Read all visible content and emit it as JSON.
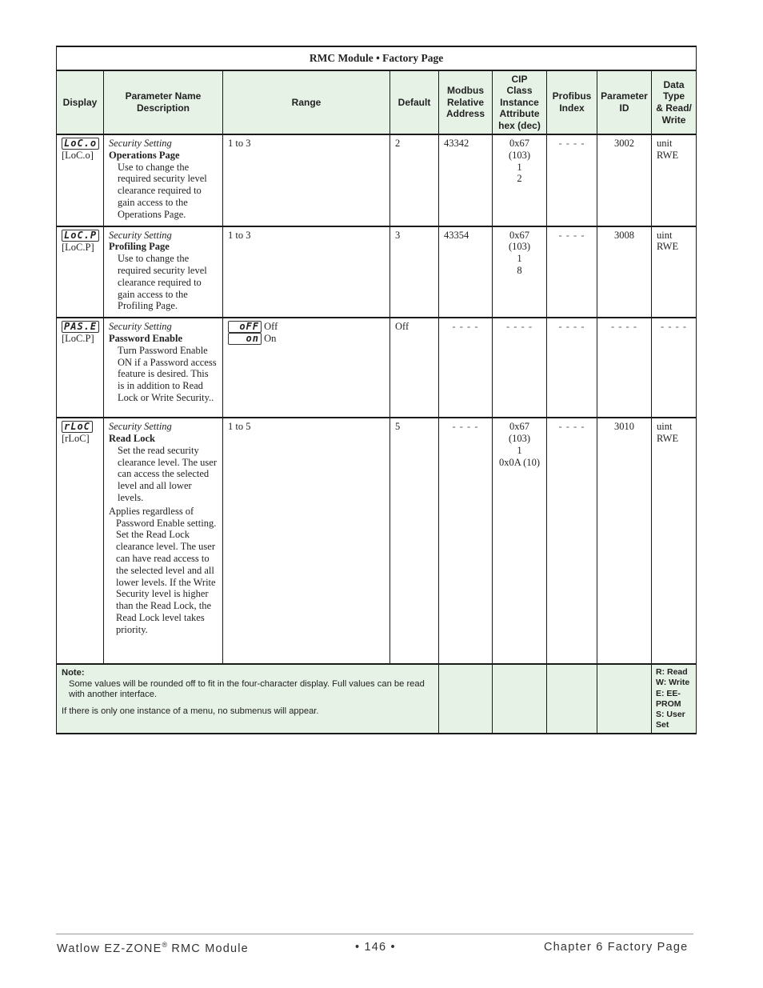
{
  "title": "RMC Module  •  Factory Page",
  "columns": {
    "display": "Display",
    "name": [
      "Parameter Name",
      "Description"
    ],
    "range": "Range",
    "default": "Default",
    "modbus": [
      "Modbus",
      "Relative",
      "Address"
    ],
    "cip": [
      "CIP",
      "Class",
      "Instance",
      "Attribute",
      "hex (dec)"
    ],
    "profibus": [
      "Profibus",
      "Index"
    ],
    "param_id": [
      "Parameter",
      "ID"
    ],
    "data_type": [
      "Data",
      "Type",
      "& Read/",
      "Write"
    ]
  },
  "rows": [
    {
      "display_code": "LoC.o",
      "display_label": "[LoC.o]",
      "category": "Security Setting",
      "name": "Operations Page",
      "description": "Use to change the required security level clearance required to gain access to the Operations Page.",
      "range": "1 to 3",
      "default": "2",
      "modbus": "43342",
      "cip": [
        "0x67 (103)",
        "1",
        "2"
      ],
      "profibus": "- - - -",
      "param_id": "3002",
      "data_type": [
        "unit",
        "RWE"
      ]
    },
    {
      "display_code": "LoC.P",
      "display_label": "[LoC.P]",
      "category": "Security Setting",
      "name": "Profiling Page",
      "description": "Use to change the required security level clearance required to gain access to the Profiling Page.",
      "range": "1 to 3",
      "default": "3",
      "modbus": "43354",
      "cip": [
        "0x67 (103)",
        "1",
        "8"
      ],
      "profibus": "- - - -",
      "param_id": "3008",
      "data_type": [
        "uint",
        "RWE"
      ]
    },
    {
      "display_code": "PAS.E",
      "display_label": "[LoC.P]",
      "category": "Security Setting",
      "name": "Password Enable",
      "description": "Turn Password Enable ON if a Password access feature is desired. This is in addition to Read Lock or Write Security..",
      "range_options": [
        {
          "code": "oFF",
          "label": "Off"
        },
        {
          "code": "on",
          "label": "On"
        }
      ],
      "default": "Off",
      "modbus": "- - - -",
      "cip": "- - - -",
      "profibus": "- - - -",
      "param_id": "- - - -",
      "data_type": "- - - -"
    },
    {
      "display_code": "rLoC",
      "display_label": "[rLoC]",
      "category": "Security Setting",
      "name": "Read Lock",
      "description": "Set the read security clearance level. The user can access the selected level and all lower levels.",
      "description2": "Applies regardless of Password Enable setting. Set the Read Lock clearance level. The user can have read access to the selected level and all lower levels. If the Write Security level is higher than the Read Lock, the Read Lock level takes priority.",
      "range": "1 to 5",
      "default": "5",
      "modbus": "- - - -",
      "cip": [
        "0x67 (103)",
        "1",
        "0x0A (10)"
      ],
      "profibus": "- - - -",
      "param_id": "3010",
      "data_type": [
        "uint",
        "RWE"
      ]
    }
  ],
  "note": {
    "title": "Note:",
    "p1": "Some values will be rounded off to fit in the four-character display. Full values can be read with another interface.",
    "p2": "If there is only one instance of a menu, no submenus will appear.",
    "legend": [
      "R: Read",
      "W: Write",
      "E: EE-PROM",
      "S: User Set"
    ]
  },
  "footer": {
    "left": "Watlow EZ-ZONE",
    "left_sup": "®",
    "left_after": " RMC Module",
    "center": "• 146 •",
    "right": "Chapter 6 Factory Page"
  }
}
